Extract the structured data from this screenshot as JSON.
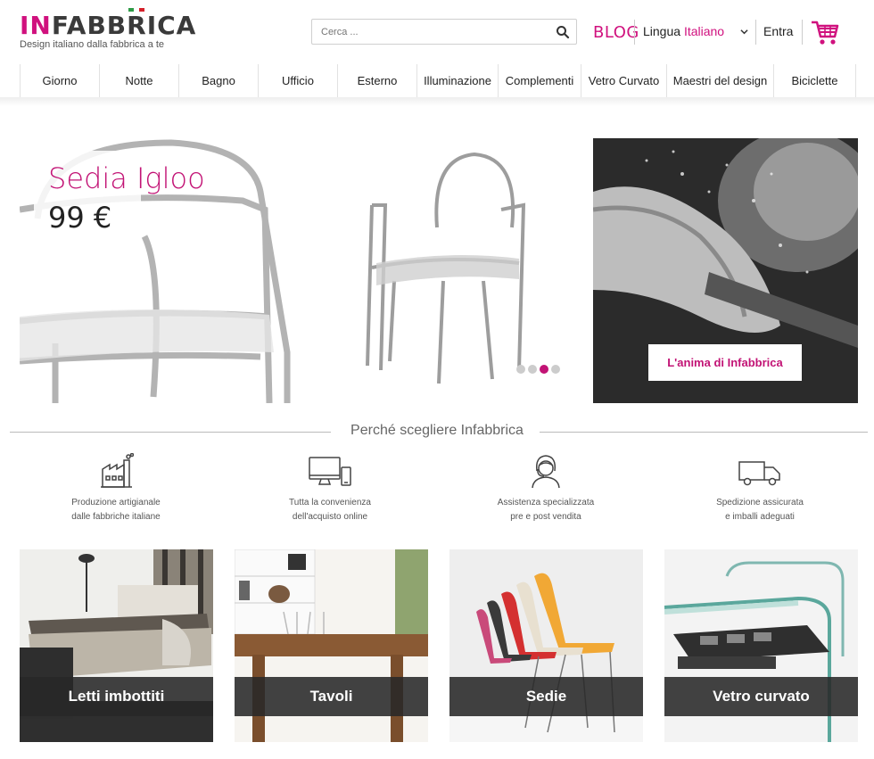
{
  "brand": {
    "logo_in": "IN",
    "logo_rest": "FABBRICA",
    "tagline": "Design italiano dalla fabbrica a te",
    "accent": "#c21375"
  },
  "search": {
    "placeholder": "Cerca ...",
    "icon": "search-icon"
  },
  "header": {
    "blog_label": "BLOG",
    "lang_label": "Lingua",
    "lang_value": "Italiano",
    "login_label": "Entra",
    "cart_icon": "cart-icon"
  },
  "nav": {
    "items": [
      {
        "label": "Giorno"
      },
      {
        "label": "Notte"
      },
      {
        "label": "Bagno"
      },
      {
        "label": "Ufficio"
      },
      {
        "label": "Esterno"
      },
      {
        "label": "Illuminazione"
      },
      {
        "label": "Complementi"
      },
      {
        "label": "Vetro Curvato"
      },
      {
        "label": "Maestri del design"
      },
      {
        "label": "Biciclette"
      }
    ]
  },
  "hero": {
    "title": "Sedia Igloo",
    "price": "99 €",
    "slides_total": 4,
    "slide_active": 3
  },
  "anima": {
    "button": "L'anima di Infabbrica"
  },
  "why": {
    "title": "Perché scegliere Infabbrica",
    "features": [
      {
        "icon": "factory-icon",
        "line1": "Produzione artigianale",
        "line2": "dalle fabbriche italiane"
      },
      {
        "icon": "devices-icon",
        "line1": "Tutta la convenienza",
        "line2": "dell'acquisto online"
      },
      {
        "icon": "operator-icon",
        "line1": "Assistenza specializzata",
        "line2": "pre e post vendita"
      },
      {
        "icon": "truck-icon",
        "line1": "Spedizione assicurata",
        "line2": "e imballi adeguati"
      }
    ]
  },
  "categories": [
    {
      "label": "Letti imbottiti"
    },
    {
      "label": "Tavoli"
    },
    {
      "label": "Sedie"
    },
    {
      "label": "Vetro curvato"
    }
  ]
}
